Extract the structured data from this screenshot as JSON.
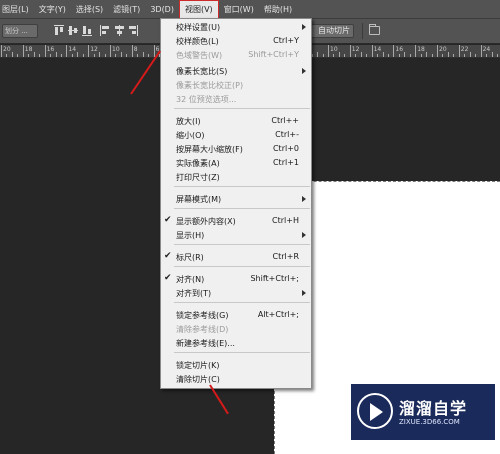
{
  "menubar": {
    "items": [
      "图层(L)",
      "文字(Y)",
      "选择(S)",
      "滤镜(T)",
      "3D(D)",
      "视图(V)",
      "窗口(W)",
      "帮助(H)"
    ],
    "active_index": 5
  },
  "optionsbar": {
    "slice_select": "划分 ...",
    "auto_slice_button": "自动切片"
  },
  "ruler": {
    "labels": [
      "20",
      "18",
      "16",
      "14",
      "12",
      "10",
      "8",
      "6",
      "4",
      "2",
      "0",
      "2",
      "4",
      "6",
      "8",
      "10",
      "12",
      "14",
      "16",
      "18",
      "20",
      "22",
      "24"
    ]
  },
  "view_menu": {
    "items": [
      {
        "label": "校样设置(U)",
        "shortcut": "",
        "submenu": true,
        "disabled": false,
        "checked": false
      },
      {
        "label": "校样颜色(L)",
        "shortcut": "Ctrl+Y",
        "submenu": false,
        "disabled": false,
        "checked": false
      },
      {
        "label": "色域警告(W)",
        "shortcut": "Shift+Ctrl+Y",
        "submenu": false,
        "disabled": true,
        "checked": false
      },
      {
        "label": "像素长宽比(S)",
        "shortcut": "",
        "submenu": true,
        "disabled": false,
        "checked": false
      },
      {
        "label": "像素长宽比校正(P)",
        "shortcut": "",
        "submenu": false,
        "disabled": true,
        "checked": false
      },
      {
        "label": "32 位预览选项...",
        "shortcut": "",
        "submenu": false,
        "disabled": true,
        "checked": false
      },
      {
        "label": "放大(I)",
        "shortcut": "Ctrl++",
        "submenu": false,
        "disabled": false,
        "checked": false
      },
      {
        "label": "缩小(O)",
        "shortcut": "Ctrl+-",
        "submenu": false,
        "disabled": false,
        "checked": false
      },
      {
        "label": "按屏幕大小缩放(F)",
        "shortcut": "Ctrl+0",
        "submenu": false,
        "disabled": false,
        "checked": false
      },
      {
        "label": "实际像素(A)",
        "shortcut": "Ctrl+1",
        "submenu": false,
        "disabled": false,
        "checked": false
      },
      {
        "label": "打印尺寸(Z)",
        "shortcut": "",
        "submenu": false,
        "disabled": false,
        "checked": false
      },
      {
        "label": "屏幕模式(M)",
        "shortcut": "",
        "submenu": true,
        "disabled": false,
        "checked": false
      },
      {
        "label": "显示额外内容(X)",
        "shortcut": "Ctrl+H",
        "submenu": false,
        "disabled": false,
        "checked": true
      },
      {
        "label": "显示(H)",
        "shortcut": "",
        "submenu": true,
        "disabled": false,
        "checked": false
      },
      {
        "label": "标尺(R)",
        "shortcut": "Ctrl+R",
        "submenu": false,
        "disabled": false,
        "checked": true
      },
      {
        "label": "对齐(N)",
        "shortcut": "Shift+Ctrl+;",
        "submenu": false,
        "disabled": false,
        "checked": true
      },
      {
        "label": "对齐到(T)",
        "shortcut": "",
        "submenu": true,
        "disabled": false,
        "checked": false
      },
      {
        "label": "锁定参考线(G)",
        "shortcut": "Alt+Ctrl+;",
        "submenu": false,
        "disabled": false,
        "checked": false
      },
      {
        "label": "清除参考线(D)",
        "shortcut": "",
        "submenu": false,
        "disabled": true,
        "checked": false
      },
      {
        "label": "新建参考线(E)...",
        "shortcut": "",
        "submenu": false,
        "disabled": false,
        "checked": false
      },
      {
        "label": "锁定切片(K)",
        "shortcut": "",
        "submenu": false,
        "disabled": false,
        "checked": false
      },
      {
        "label": "清除切片(C)",
        "shortcut": "",
        "submenu": false,
        "disabled": false,
        "checked": false
      }
    ]
  },
  "watermark": {
    "brand": "溜溜自学",
    "url": "ZIXUE.3D66.COM"
  },
  "colors": {
    "annotation_red": "#d51a1a",
    "menu_bg": "#f0f0f0",
    "app_bg": "#262626"
  }
}
